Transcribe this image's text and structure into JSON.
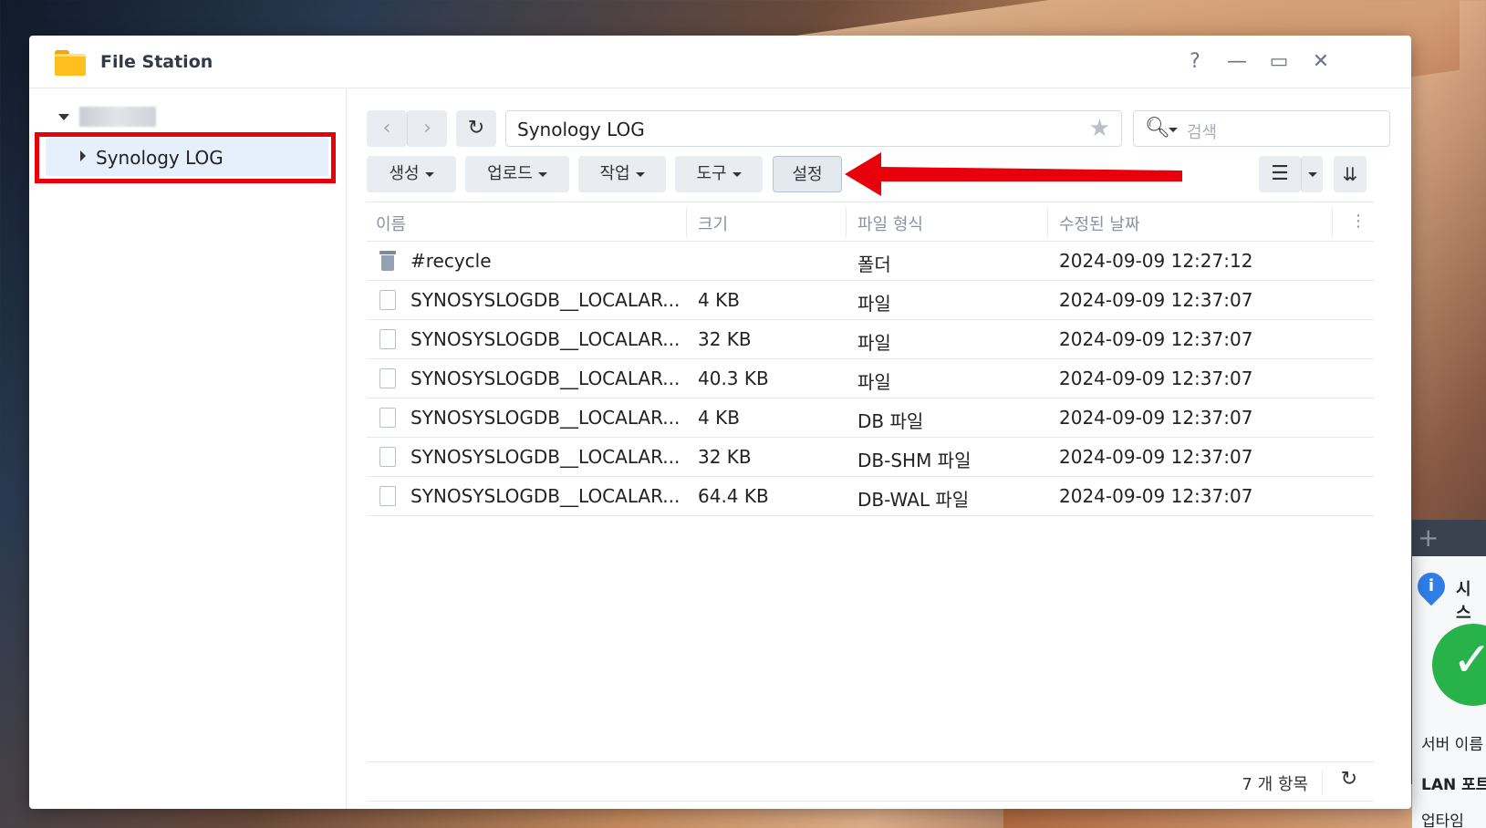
{
  "window": {
    "title": "File Station"
  },
  "window_controls": {
    "help": "?",
    "minimize": "—",
    "maximize": "▭",
    "close": "✕"
  },
  "sidebar": {
    "items": [
      {
        "label": "Synology LOG",
        "selected": true
      }
    ]
  },
  "toolbar": {
    "back": "‹",
    "forward": "›",
    "refresh": "↻",
    "path": "Synology LOG",
    "search_placeholder": "검색",
    "create": "생성",
    "upload": "업로드",
    "action": "작업",
    "tools": "도구",
    "settings": "설정"
  },
  "table": {
    "headers": {
      "name": "이름",
      "size": "크기",
      "type": "파일 형식",
      "modified": "수정된 날짜"
    },
    "rows": [
      {
        "name": "#recycle",
        "size": "",
        "type": "폴더",
        "modified": "2024-09-09 12:27:12",
        "icon": "trash-icon"
      },
      {
        "name": "SYNOSYSLOGDB__LOCALAR...",
        "size": "4 KB",
        "type": "파일",
        "modified": "2024-09-09 12:37:07",
        "icon": "file-icon"
      },
      {
        "name": "SYNOSYSLOGDB__LOCALAR...",
        "size": "32 KB",
        "type": "파일",
        "modified": "2024-09-09 12:37:07",
        "icon": "file-icon"
      },
      {
        "name": "SYNOSYSLOGDB__LOCALAR...",
        "size": "40.3 KB",
        "type": "파일",
        "modified": "2024-09-09 12:37:07",
        "icon": "file-icon"
      },
      {
        "name": "SYNOSYSLOGDB__LOCALAR...",
        "size": "4 KB",
        "type": "DB 파일",
        "modified": "2024-09-09 12:37:07",
        "icon": "file-icon"
      },
      {
        "name": "SYNOSYSLOGDB__LOCALAR...",
        "size": "32 KB",
        "type": "DB-SHM 파일",
        "modified": "2024-09-09 12:37:07",
        "icon": "file-icon"
      },
      {
        "name": "SYNOSYSLOGDB__LOCALAR...",
        "size": "64.4 KB",
        "type": "DB-WAL 파일",
        "modified": "2024-09-09 12:37:07",
        "icon": "file-icon"
      }
    ]
  },
  "footer": {
    "count": "7 개 항목"
  },
  "widget": {
    "sys": "시스",
    "server": "서버 이름",
    "lan": "LAN 포트",
    "uptime": "업타임"
  },
  "colors": {
    "highlight": "#e8000a",
    "accent": "#2f7ee8",
    "selected_bg": "#e6f0fc"
  }
}
